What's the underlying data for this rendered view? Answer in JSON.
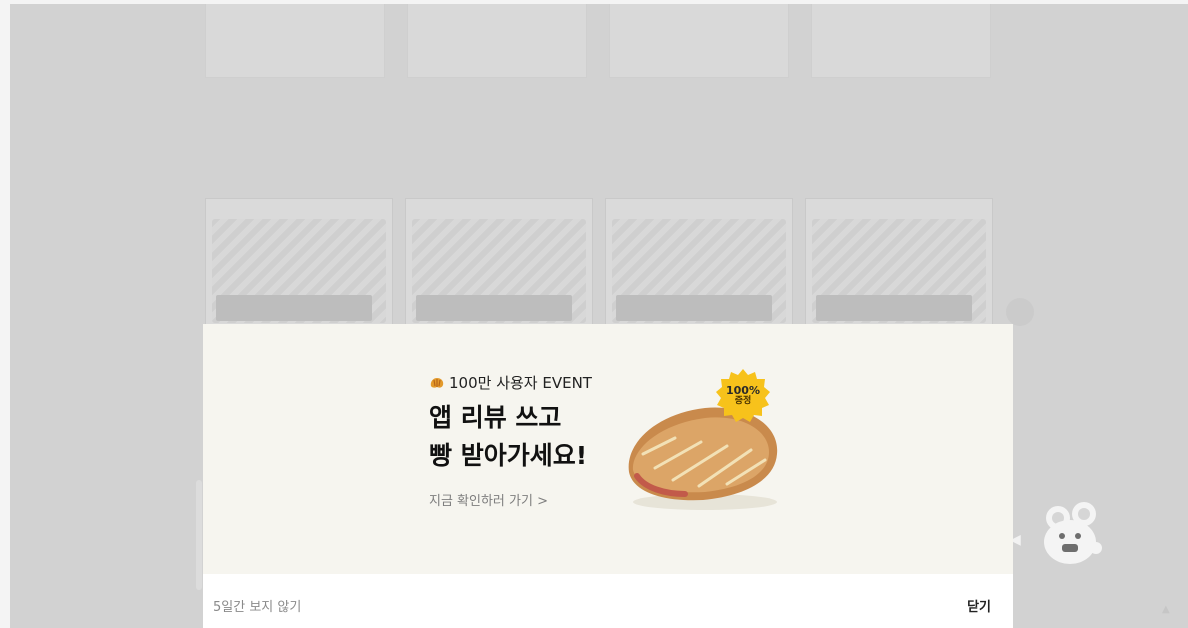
{
  "background": {
    "cards_top": [
      {
        "text": "",
        "meta": ""
      },
      {
        "text": "",
        "meta": ""
      },
      {
        "text": "",
        "meta": ""
      },
      {
        "text": "",
        "meta": ""
      }
    ],
    "section": {
      "title": "",
      "subtitle": ""
    },
    "video_cards": [
      {
        "tag": ""
      },
      {
        "tag": ""
      },
      {
        "tag": ""
      },
      {
        "tag": ""
      }
    ]
  },
  "modal": {
    "event_label": "100만 사용자 EVENT",
    "headline_line1": "앱 리뷰 쓰고",
    "headline_line2": "빵 받아가세요!",
    "cta": "지금 확인하러 가기 >",
    "badge_line1": "100%",
    "badge_line2": "증정",
    "hide_5days": "5일간 보지 않기",
    "close": "닫기"
  },
  "icons": {
    "croissant": "croissant-icon",
    "mascot": "mascot-icon"
  },
  "colors": {
    "banner_bg": "#f6f5ef",
    "badge_yellow": "#f7c21b",
    "overlay_gray": "#d2d2d2"
  }
}
